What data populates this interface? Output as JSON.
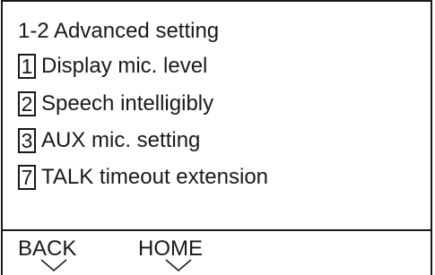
{
  "screen": {
    "title": "1-2 Advanced setting"
  },
  "menu": {
    "items": [
      {
        "key": "1",
        "label": "Display mic. level"
      },
      {
        "key": "2",
        "label": "Speech intelligibly"
      },
      {
        "key": "3",
        "label": "AUX mic. setting"
      },
      {
        "key": "7",
        "label": "TALK timeout extension"
      }
    ]
  },
  "softkeys": {
    "back_label": "BACK",
    "home_label": "HOME"
  }
}
